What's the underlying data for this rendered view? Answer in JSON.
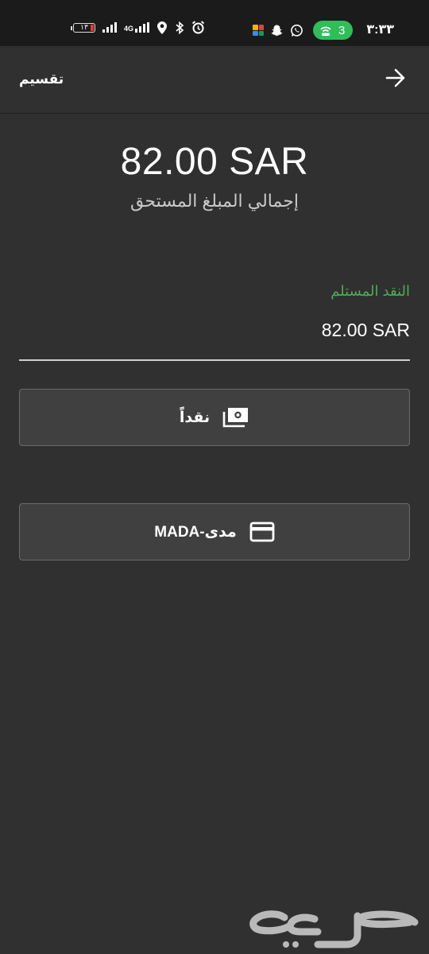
{
  "status_bar": {
    "time": "٣:٣٣",
    "battery_level": "١٣",
    "network": "4G",
    "hotspot_count": "3"
  },
  "toolbar": {
    "title": "تقسيم",
    "back_icon": "arrow-right-icon"
  },
  "summary": {
    "total_amount": "82.00 SAR",
    "total_caption": "إجمالي المبلغ المستحق"
  },
  "cash_received": {
    "label": "النقد المستلم",
    "value": "82.00 SAR"
  },
  "payment_methods": [
    {
      "label": "نقداً",
      "icon": "cash-icon"
    },
    {
      "label": "مدى-MADA",
      "icon": "credit-card-icon"
    }
  ],
  "watermark": {
    "text": "حراج"
  },
  "colors": {
    "background": "#303030",
    "status_bar": "#1b1b1b",
    "accent_green": "#4caf50",
    "hotspot_green": "#2fbe57",
    "button_bg": "#404040"
  }
}
